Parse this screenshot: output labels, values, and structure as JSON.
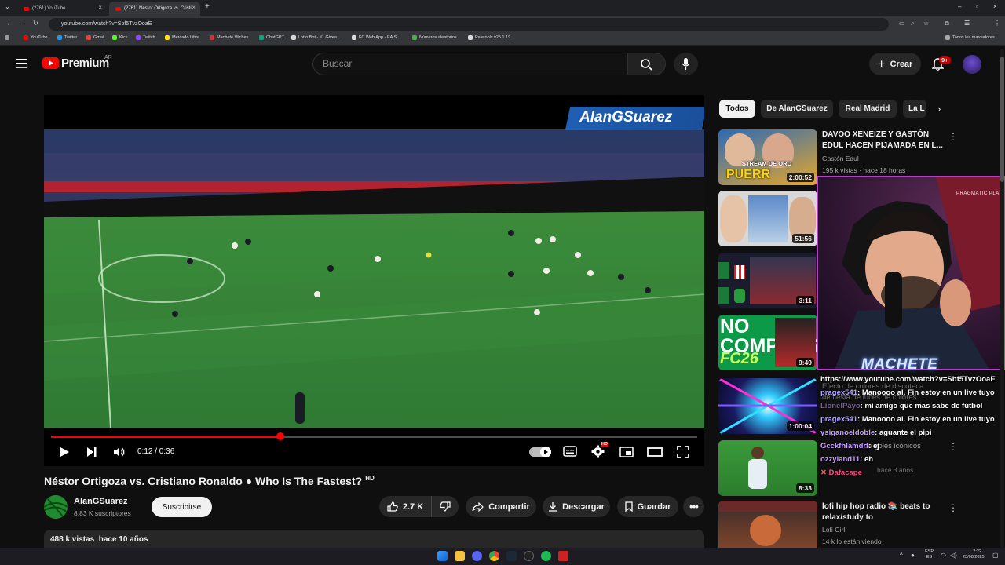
{
  "browser": {
    "tabs": [
      {
        "label": "(2761) YouTube",
        "active": false
      },
      {
        "label": "(2761) Néstor Ortigoza vs. Cristi",
        "active": true
      }
    ],
    "url": "youtube.com/watch?v=Sbf5TvzOoaE",
    "bookmarks": [
      "YouTube",
      "Twitter",
      "Gmail",
      "Kick",
      "Twitch",
      "Mercado Libre",
      "Machete Vilches",
      "ChatGPT",
      "Lotto Bot - #1 Givea...",
      "FC Web App - EA S...",
      "Números aleatorios",
      "Paletools v25.1.19"
    ],
    "all_bookmarks": "Todos los marcadores"
  },
  "header": {
    "logo": "Premium",
    "region": "AR",
    "search_placeholder": "Buscar",
    "create_label": "Crear",
    "notif_count": "9+"
  },
  "player": {
    "watermark": "AlanGSuarez",
    "time": "0:12 / 0:36",
    "progress": 0.355,
    "hd_badge": "HD"
  },
  "video": {
    "title": "Néstor Ortigoza vs. Cristiano Ronaldo ● Who Is The Fastest?",
    "hd": "HD",
    "channel": "AlanGSuarez",
    "subscribers": "8.83 K suscriptores",
    "subscribe_label": "Suscribirse",
    "likes": "2.7 K",
    "share_label": "Compartir",
    "download_label": "Descargar",
    "save_label": "Guardar",
    "views_date": "488 k vistas  hace 10 años"
  },
  "chips": [
    "Todos",
    "De AlanGSuarez",
    "Real Madrid",
    "La L"
  ],
  "sidebar": [
    {
      "title": "DAVOO XENEIZE Y GASTÓN EDUL HACEN PIJAMADA EN L...",
      "channel": "Gastón Edul",
      "meta": "195 k vistas · hace 18 horas",
      "duration": "2:00:52"
    },
    {
      "title": "",
      "channel": "",
      "meta": "",
      "duration": "51:56"
    },
    {
      "title": "",
      "channel": "",
      "meta": "",
      "duration": "3:11"
    },
    {
      "title": "",
      "channel": "",
      "meta": "",
      "duration": "9:49"
    },
    {
      "title": "",
      "channel": "",
      "meta": "",
      "duration": "1:00:04"
    },
    {
      "title": "",
      "channel": "",
      "meta": "",
      "duration": "8:33"
    },
    {
      "title": "lofi hip hop radio 📚 beats to relax/study to",
      "channel": "Lofi Girl",
      "meta": "14 k lo están viendo",
      "duration": ""
    }
  ],
  "sidebar_fragments": {
    "effect_title": "Efecto de colores de discoteca",
    "effect_sub": "de fiesta de luces de colores ...",
    "goals_title": "de goles icónicos",
    "goals_meta": "hace 3 años"
  },
  "thumb_text": {
    "t1": "STREAM DE ORO",
    "t1b": "PUERR",
    "t4": "NO COMPRES",
    "t4b": "FC26"
  },
  "stream": {
    "cam_label": "MACHETE",
    "sponsor": "PRAGMATIC PLAY",
    "chat": [
      {
        "user": "",
        "text": "https://www.youtube.com/watch?v=Sbf5TvzOoaE"
      },
      {
        "user": "pragex541",
        "text": ": Manoooo al. Fin estoy en un live tuyo"
      },
      {
        "user": "LionelPayo",
        "text": ": mi amigo que mas sabe de fútbol"
      },
      {
        "user": "pragex541",
        "text": ": Manoooo al. Fin estoy en un live tuyo"
      },
      {
        "user": "ysiganoeldoble",
        "text": ": aguante el pipi"
      },
      {
        "user": "Gcckfhlamdrt",
        "text": ": ej"
      },
      {
        "user": "ozzyland11",
        "text": ": eh"
      },
      {
        "user": "Dafacape",
        "text": ""
      }
    ]
  },
  "taskbar": {
    "lang": "ESP",
    "lang2": "ES",
    "time": "2:22",
    "date": "23/08/2025"
  }
}
